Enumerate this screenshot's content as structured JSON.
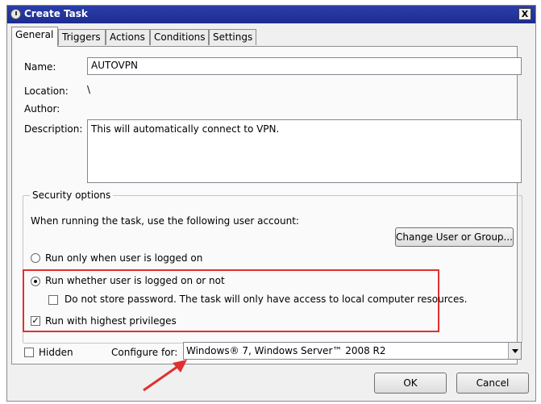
{
  "window": {
    "title": "Create Task",
    "close_glyph": "X"
  },
  "tabs": [
    {
      "label": "General",
      "active": true
    },
    {
      "label": "Triggers",
      "active": false
    },
    {
      "label": "Actions",
      "active": false
    },
    {
      "label": "Conditions",
      "active": false
    },
    {
      "label": "Settings",
      "active": false
    }
  ],
  "general": {
    "name_label": "Name:",
    "name_value": "AUTOVPN",
    "location_label": "Location:",
    "location_value": "\\",
    "author_label": "Author:",
    "author_value": "",
    "description_label": "Description:",
    "description_value": "This will automatically connect to VPN."
  },
  "security": {
    "title": "Security options",
    "account_text": "When running the task, use the following user account:",
    "change_user_button": "Change User or Group...",
    "run_logged_on_label": "Run only when user is logged on",
    "run_whether_label": "Run whether user is logged on or not",
    "do_not_store_label": "Do not store password.  The task will only have access to local computer resources.",
    "highest_privileges_label": "Run with highest privileges",
    "run_logged_on_checked": false,
    "run_whether_checked": true,
    "do_not_store_checked": false,
    "highest_privileges_checked": true,
    "highest_privileges_glyph": "✓"
  },
  "bottom": {
    "hidden_label": "Hidden",
    "hidden_checked": false,
    "configure_label": "Configure for:",
    "configure_value": "Windows® 7, Windows Server™ 2008 R2"
  },
  "buttons": {
    "ok": "OK",
    "cancel": "Cancel"
  },
  "colors": {
    "title_bar": "#1d2c91",
    "highlight": "#e03030"
  },
  "icons": {
    "title": "task-clock-icon",
    "close": "close-icon",
    "dropdown": "chevron-down-icon",
    "annotation": "arrow-annotation-icon"
  }
}
